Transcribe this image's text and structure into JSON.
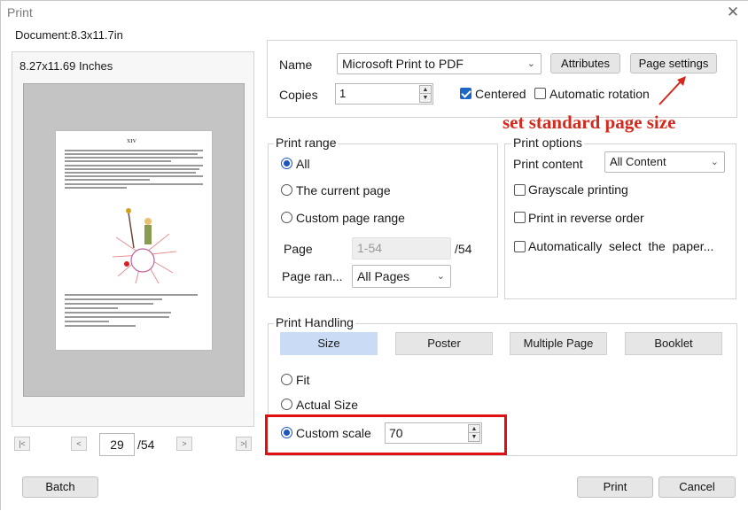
{
  "window": {
    "title": "Print",
    "close_glyph": "✕"
  },
  "document_label": "Document:8.3x11.7in",
  "preview": {
    "size_label": "8.27x11.69 Inches",
    "thumb_heading": "XIV",
    "current_page": "29",
    "total_pages": "/54",
    "nav": {
      "first": "|<",
      "prev": "<",
      "next": ">",
      "last": ">|"
    }
  },
  "printer": {
    "name_label": "Name",
    "name_value": "Microsoft Print to PDF",
    "attributes_button": "Attributes",
    "page_settings_button": "Page settings",
    "copies_label": "Copies",
    "copies_value": "1",
    "centered_label": "Centered",
    "centered_checked": true,
    "auto_rotation_label": "Automatic rotation",
    "auto_rotation_checked": false
  },
  "annotation": {
    "text": "set standard page size",
    "color": "#d42a1e"
  },
  "print_range": {
    "title": "Print range",
    "options": [
      "All",
      "The current page",
      "Custom page range"
    ],
    "selected": "All",
    "page_label": "Page",
    "page_value": "1-54",
    "page_total": "/54",
    "page_range_label": "Page ran...",
    "page_range_value": "All Pages"
  },
  "print_options": {
    "title": "Print options",
    "content_label": "Print content",
    "content_value": "All Content",
    "checkboxes": [
      "Grayscale printing",
      "Print in reverse order",
      "Automatically  select  the  paper..."
    ]
  },
  "print_handling": {
    "title": "Print Handling",
    "tabs": [
      "Size",
      "Poster",
      "Multiple Page",
      "Booklet"
    ],
    "active_tab": "Size",
    "options": [
      "Fit",
      "Actual Size",
      "Custom scale"
    ],
    "selected": "Custom scale",
    "scale_value": "70"
  },
  "footer": {
    "batch_button": "Batch",
    "print_button": "Print",
    "cancel_button": "Cancel"
  },
  "colors": {
    "accent": "#1a56c2",
    "highlight_box": "#e01010",
    "active_tab": "#c9dbf5"
  }
}
